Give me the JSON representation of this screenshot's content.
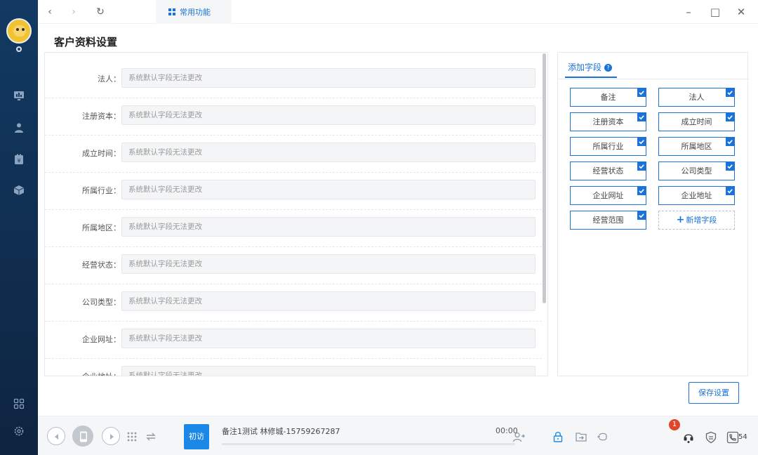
{
  "topbar": {
    "func_tab_label": "常用功能"
  },
  "page": {
    "title": "客户资料设置"
  },
  "form": {
    "rows": [
      {
        "label": "法人：",
        "placeholder": "系统默认字段无法更改"
      },
      {
        "label": "注册资本：",
        "placeholder": "系统默认字段无法更改"
      },
      {
        "label": "成立时间：",
        "placeholder": "系统默认字段无法更改"
      },
      {
        "label": "所属行业：",
        "placeholder": "系统默认字段无法更改"
      },
      {
        "label": "所属地区：",
        "placeholder": "系统默认字段无法更改"
      },
      {
        "label": "经营状态：",
        "placeholder": "系统默认字段无法更改"
      },
      {
        "label": "公司类型：",
        "placeholder": "系统默认字段无法更改"
      },
      {
        "label": "企业网址：",
        "placeholder": "系统默认字段无法更改"
      },
      {
        "label": "企业地址：",
        "placeholder": "系统默认字段无法更改"
      }
    ]
  },
  "fields_panel": {
    "tab_label": "添加字段",
    "chips": [
      {
        "label": "备注",
        "checked": true
      },
      {
        "label": "法人",
        "checked": true
      },
      {
        "label": "注册资本",
        "checked": true
      },
      {
        "label": "成立时间",
        "checked": true
      },
      {
        "label": "所属行业",
        "checked": true
      },
      {
        "label": "所属地区",
        "checked": true
      },
      {
        "label": "经营状态",
        "checked": true
      },
      {
        "label": "公司类型",
        "checked": true
      },
      {
        "label": "企业网址",
        "checked": true
      },
      {
        "label": "企业地址",
        "checked": true
      },
      {
        "label": "经营范围",
        "checked": true
      }
    ],
    "add_field_label": "新增字段"
  },
  "actions": {
    "save_label": "保存设置"
  },
  "bottombar": {
    "first_visit_label": "初访",
    "call_info": "备注1测试   林修城-15759267287",
    "call_time": "00:00",
    "notification_count": "1",
    "count_value": "54"
  },
  "colors": {
    "sidebar_top": "#123a63",
    "sidebar_bottom": "#0e2440",
    "accent": "#1b72d8",
    "first_visit": "#1b87e6",
    "badge": "#e0452b"
  }
}
